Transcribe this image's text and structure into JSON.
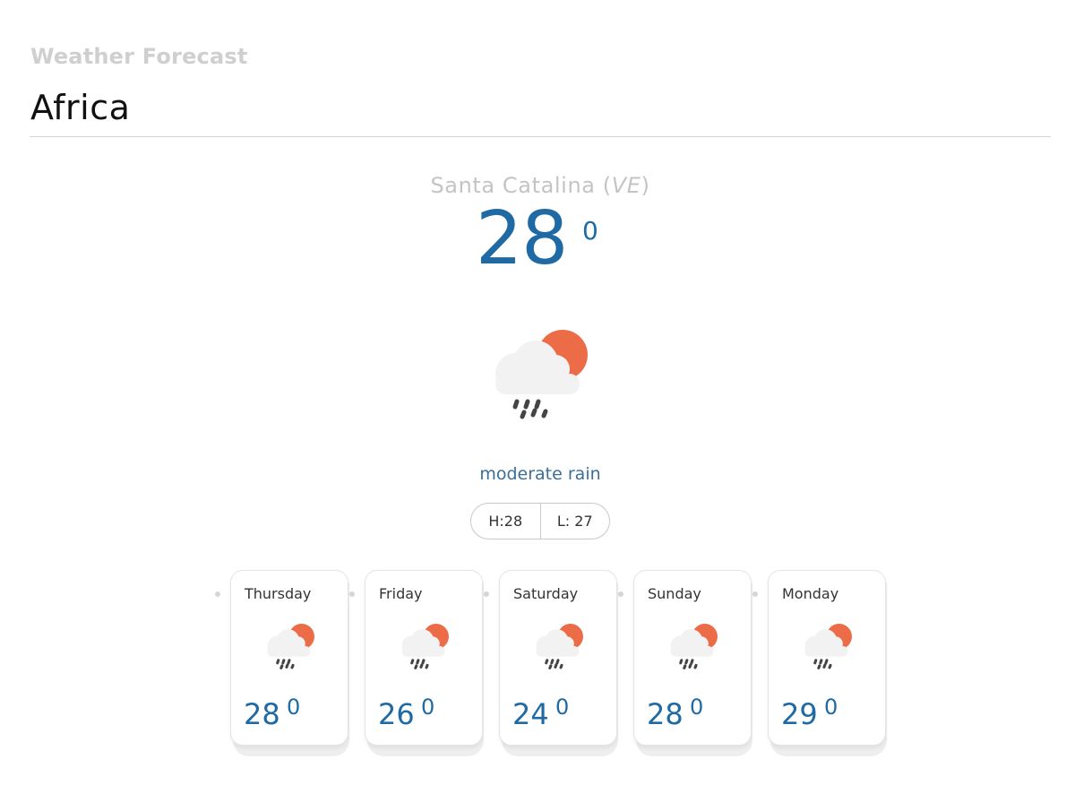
{
  "header": {
    "app_label": "Weather Forecast",
    "region": "Africa"
  },
  "current": {
    "city": "Santa Catalina",
    "country": "VE",
    "temperature": "28",
    "degree_symbol": "0",
    "condition": "moderate rain",
    "icon": "cloud-sun-rain-icon",
    "high": "H:28",
    "low": "L: 27"
  },
  "forecast": [
    {
      "day": "Thursday",
      "temp": "28",
      "degree_symbol": "0",
      "icon": "cloud-sun-rain-icon"
    },
    {
      "day": "Friday",
      "temp": "26",
      "degree_symbol": "0",
      "icon": "cloud-sun-rain-icon"
    },
    {
      "day": "Saturday",
      "temp": "24",
      "degree_symbol": "0",
      "icon": "cloud-sun-rain-icon"
    },
    {
      "day": "Sunday",
      "temp": "28",
      "degree_symbol": "0",
      "icon": "cloud-sun-rain-icon"
    },
    {
      "day": "Monday",
      "temp": "29",
      "degree_symbol": "0",
      "icon": "cloud-sun-rain-icon"
    }
  ],
  "colors": {
    "accent": "#1f6aa5",
    "sun": "#ed6c48",
    "cloud": "#f2f2f2",
    "rain": "#444444"
  }
}
